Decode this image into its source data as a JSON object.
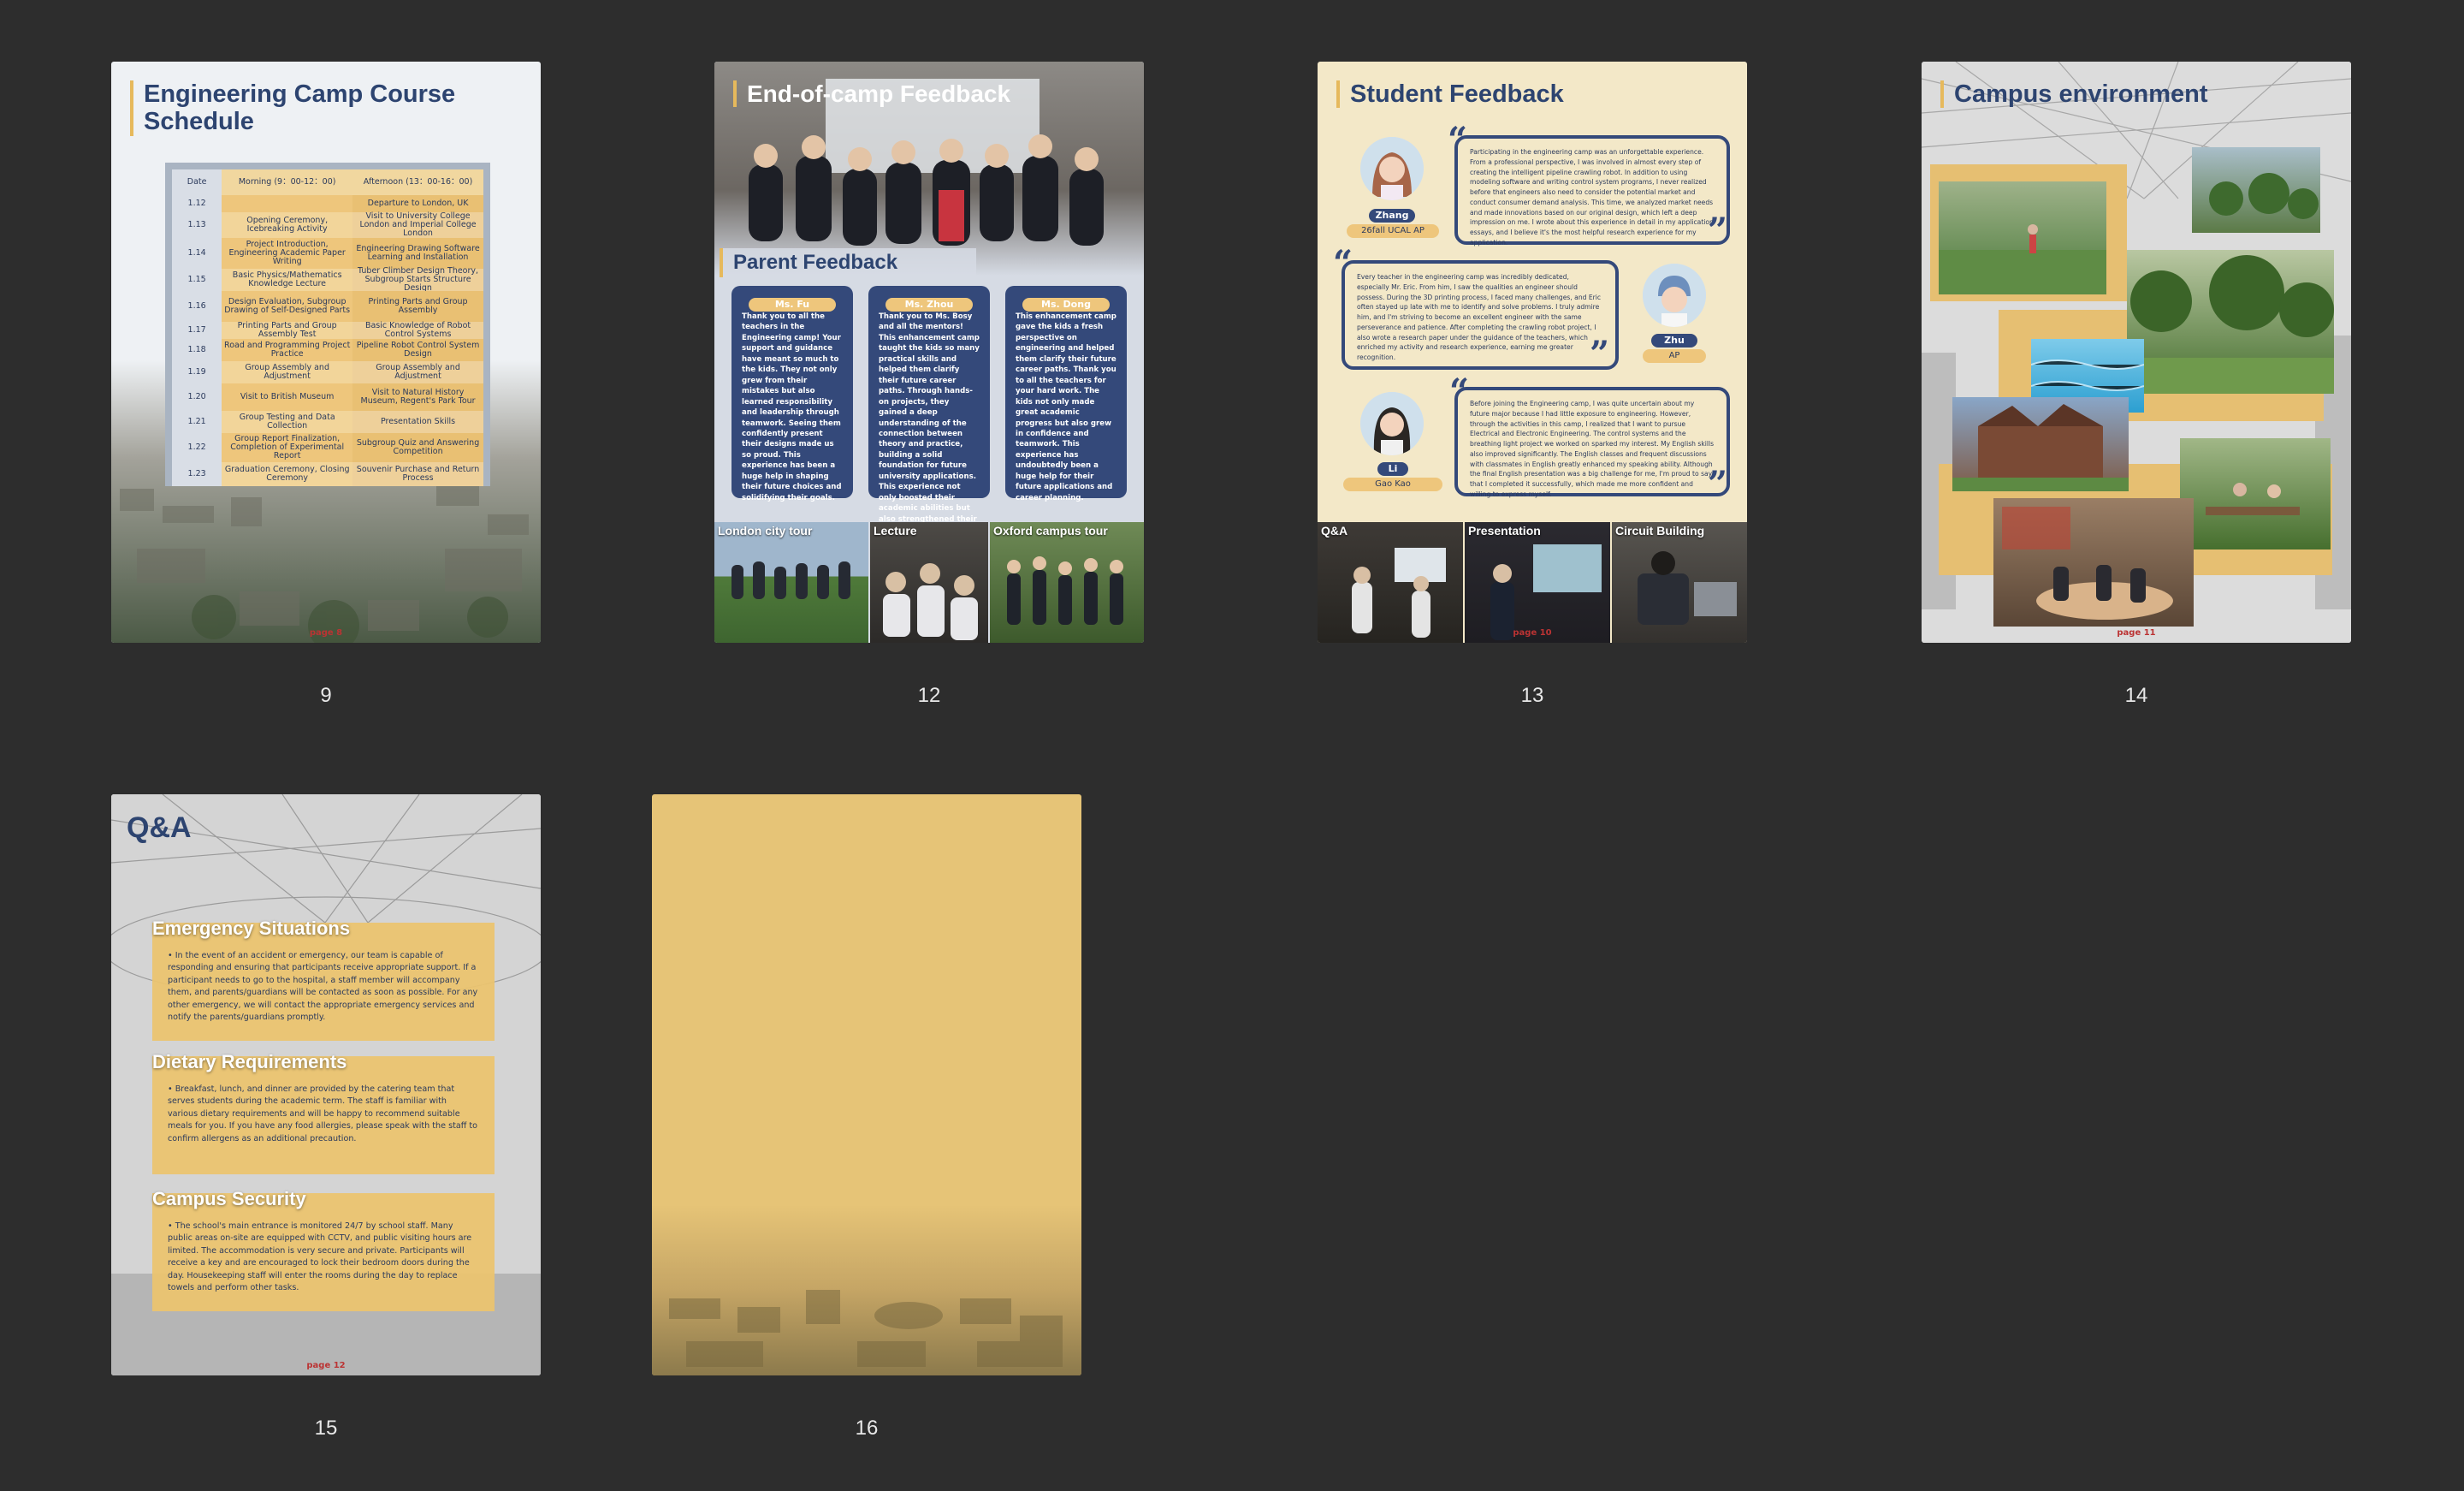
{
  "thumbnails": [
    {
      "number": "9"
    },
    {
      "number": "12"
    },
    {
      "number": "13"
    },
    {
      "number": "14"
    },
    {
      "number": "15"
    },
    {
      "number": "16"
    }
  ],
  "page9": {
    "title": "Engineering Camp Course Schedule",
    "header": {
      "date": "Date",
      "morning": "Morning (9：00-12：00)",
      "afternoon": "Afternoon (13：00-16：00)"
    },
    "rows": [
      {
        "date": "1.12",
        "morning": "",
        "afternoon": "Departure to London, UK"
      },
      {
        "date": "1.13",
        "morning": "Opening Ceremony, Icebreaking Activity",
        "afternoon": "Visit to University College London and Imperial College London"
      },
      {
        "date": "1.14",
        "morning": "Project Introduction, Engineering Academic Paper Writing",
        "afternoon": "Engineering Drawing Software Learning and Installation"
      },
      {
        "date": "1.15",
        "morning": "Basic Physics/Mathematics Knowledge Lecture",
        "afternoon": "Tuber Climber Design Theory, Subgroup Starts Structure Design"
      },
      {
        "date": "1.16",
        "morning": "Design Evaluation, Subgroup Drawing of Self-Designed Parts",
        "afternoon": "Printing Parts and Group Assembly"
      },
      {
        "date": "1.17",
        "morning": "Printing Parts and Group Assembly Test",
        "afternoon": "Basic Knowledge of Robot Control Systems"
      },
      {
        "date": "1.18",
        "morning": "Road and Programming Project Practice",
        "afternoon": "Pipeline Robot Control System Design"
      },
      {
        "date": "1.19",
        "morning": "Group Assembly and Adjustment",
        "afternoon": "Group Assembly and Adjustment"
      },
      {
        "date": "1.20",
        "morning": "Visit to British Museum",
        "afternoon": "Visit to Natural History Museum, Regent's Park Tour"
      },
      {
        "date": "1.21",
        "morning": "Group Testing and Data Collection",
        "afternoon": "Presentation Skills"
      },
      {
        "date": "1.22",
        "morning": "Group Report Finalization, Completion of Experimental Report",
        "afternoon": "Subgroup Quiz and Answering Competition"
      },
      {
        "date": "1.23",
        "morning": "Graduation Ceremony, Closing Ceremony",
        "afternoon": "Souvenir Purchase and Return Process"
      }
    ],
    "footer": "page 8"
  },
  "page12": {
    "title": "End-of-camp Feedback",
    "section": "Parent Feedback",
    "cards": [
      {
        "name": "Ms. Fu",
        "text": "Thank you to all the teachers in the Engineering camp! Your support and guidance have meant so much to the kids. They not only grew from their mistakes but also learned responsibility and leadership through teamwork. Seeing them confidently present their designs made us so proud. This experience has been a huge help in shaping their future choices and solidifying their goals."
      },
      {
        "name": "Ms. Zhou",
        "text": "Thank you to Ms. Bosy and all the mentors! This enhancement camp taught the kids so many practical skills and helped them clarify their future career paths. Through hands-on projects, they gained a deep understanding of the connection between theory and practice, building a solid foundation for future university applications. This experience not only boosted their academic abilities but also strengthened their teamwork and confidence."
      },
      {
        "name": "Ms. Dong",
        "text": "This enhancement camp gave the kids a fresh perspective on engineering and helped them clarify their future career paths. Thank you to all the teachers for your hard work. The kids not only made great academic progress but also grew in confidence and teamwork. This experience has undoubtedly been a huge help for their future applications and career planning."
      }
    ],
    "photos": [
      "London city tour",
      "Lecture",
      "Oxford campus tour"
    ]
  },
  "page13": {
    "title": "Student Feedback",
    "students": [
      {
        "name": "Zhang",
        "tag": "26fall UCAL AP",
        "text": "Participating in the engineering camp was an unforgettable experience. From a professional perspective, I was involved in almost every step of creating the intelligent pipeline crawling robot. In addition to using modeling software and writing control system programs, I never realized before that engineers also need to consider the potential market and conduct consumer demand analysis. This time, we analyzed market needs and made innovations based on our original design, which left a deep impression on me. I wrote about this experience in detail in my application essays, and I believe it's the most helpful research experience for my application."
      },
      {
        "name": "Zhu",
        "tag": "AP",
        "text": "Every teacher in the engineering camp was incredibly dedicated, especially Mr. Eric. From him, I saw the qualities an engineer should possess. During the 3D printing process, I faced many challenges, and Eric often stayed up late with me to identify and solve problems. I truly admire him, and I'm striving to become an excellent engineer with the same perseverance and patience. After completing the crawling robot project, I also wrote a research paper under the guidance of the teachers, which enriched my activity and research experience, earning me greater recognition."
      },
      {
        "name": "Li",
        "tag": "Gao Kao",
        "text": "Before joining the Engineering camp, I was quite uncertain about my future major because I had little exposure to engineering. However, through the activities in this camp, I realized that I want to pursue Electrical and Electronic Engineering. The control systems and the breathing light project we worked on sparked my interest. My English skills also improved significantly. The English classes and frequent discussions with classmates in English greatly enhanced my speaking ability. Although the final English presentation was a big challenge for me, I'm proud to say that I completed it successfully, which made me more confident and willing to express myself."
      }
    ],
    "photos": [
      "Q&A",
      "Presentation",
      "Circuit Building"
    ],
    "footer": "page 10"
  },
  "page14": {
    "title": "Campus environment",
    "footer": "page 11"
  },
  "page15": {
    "title": "Q&A",
    "sections": [
      {
        "heading": "Emergency Situations",
        "text": "In the event of an accident or emergency, our team is capable of responding and ensuring that participants receive appropriate support. If a participant needs to go to the hospital, a staff member will accompany them, and parents/guardians will be contacted as soon as possible. For any other emergency, we will contact the appropriate emergency services and notify the parents/guardians promptly."
      },
      {
        "heading": "Dietary Requirements",
        "text": "Breakfast, lunch, and dinner are provided by the catering team that serves students during the academic term. The staff is familiar with various dietary requirements and will be happy to recommend suitable meals for you. If you have any food allergies, please speak with the staff to confirm allergens as an additional precaution."
      },
      {
        "heading": "Campus Security",
        "text": "The school's main entrance is monitored 24/7 by school staff. Many public areas on-site are equipped with CCTV, and public visiting hours are limited. The accommodation is very secure and private. Participants will receive a key and are encouraged to lock their bedroom doors during the day. Housekeeping staff will enter the rooms during the day to replace towels and perform other tasks."
      }
    ],
    "footer": "page 12"
  }
}
